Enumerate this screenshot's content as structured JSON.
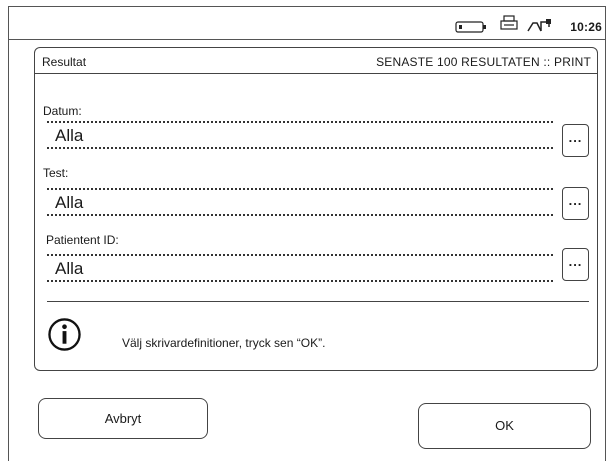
{
  "status_bar": {
    "time": "10:26",
    "icons": [
      "battery-icon",
      "printer-icon",
      "network-icon"
    ]
  },
  "panel": {
    "title": "Resultat",
    "mode": "SENASTE 100 RESULTATEN :: PRINT"
  },
  "fields": [
    {
      "label": "Datum:",
      "value": "Alla",
      "button": "..."
    },
    {
      "label": "Test:",
      "value": "Alla",
      "button": "..."
    },
    {
      "label": "Patientent ID:",
      "value": "Alla",
      "button": "..."
    }
  ],
  "info": {
    "icon": "info-icon",
    "text": "Välj skrivardefinitioner, tryck sen “OK”."
  },
  "buttons": {
    "cancel": "Avbryt",
    "ok": "OK"
  }
}
